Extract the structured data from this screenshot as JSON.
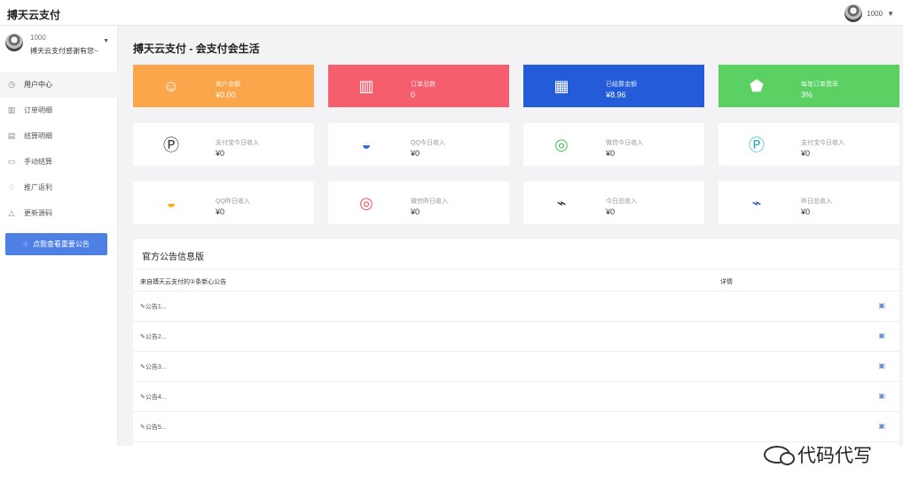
{
  "topbar": {
    "brand": "搏天云支付",
    "user": "1000"
  },
  "sidebar": {
    "user_id": "1000",
    "motto": "搏天云支付感谢有您~",
    "items": [
      {
        "label": "用户中心",
        "icon": "clock-icon"
      },
      {
        "label": "订单明细",
        "icon": "bar-chart-icon"
      },
      {
        "label": "结算明细",
        "icon": "document-icon"
      },
      {
        "label": "手动结算",
        "icon": "wallet-icon"
      },
      {
        "label": "推广返利",
        "icon": "lightbulb-icon"
      },
      {
        "label": "更新源码",
        "icon": "bell-icon"
      }
    ],
    "notice_button": "点我查看重要公告"
  },
  "main": {
    "title": "搏天云支付 - 会支付会生活",
    "stats": [
      {
        "label": "商户余额",
        "value": "¥0.00"
      },
      {
        "label": "订单总数",
        "value": "0"
      },
      {
        "label": "已结算金额",
        "value": "¥8.96"
      },
      {
        "label": "每笔订单费率",
        "value": "3%"
      }
    ],
    "today": [
      {
        "label": "支付宝今日收入",
        "value": "¥0"
      },
      {
        "label": "QQ今日收入",
        "value": "¥0"
      },
      {
        "label": "微信今日收入",
        "value": "¥0"
      },
      {
        "label": "支付宝今日收入",
        "value": "¥0"
      }
    ],
    "yesterday": [
      {
        "label": "QQ昨日收入",
        "value": "¥0"
      },
      {
        "label": "微信昨日收入",
        "value": "¥0"
      },
      {
        "label": "今日总收入",
        "value": "¥0"
      },
      {
        "label": "昨日总收入",
        "value": "¥0"
      }
    ]
  },
  "notices": {
    "title": "官方公告信息版",
    "header_left": "来自搏天云支付的①条新心公告",
    "header_right": "详情",
    "rows": [
      "公告1...",
      "公告2...",
      "公告3...",
      "公告4...",
      "公告5..."
    ]
  },
  "watermark": "代码代写",
  "colors": {
    "orange": "#fba64a",
    "red": "#f55f6d",
    "blue": "#245bd9",
    "green": "#5bd164",
    "primary": "#4d7fe5"
  }
}
